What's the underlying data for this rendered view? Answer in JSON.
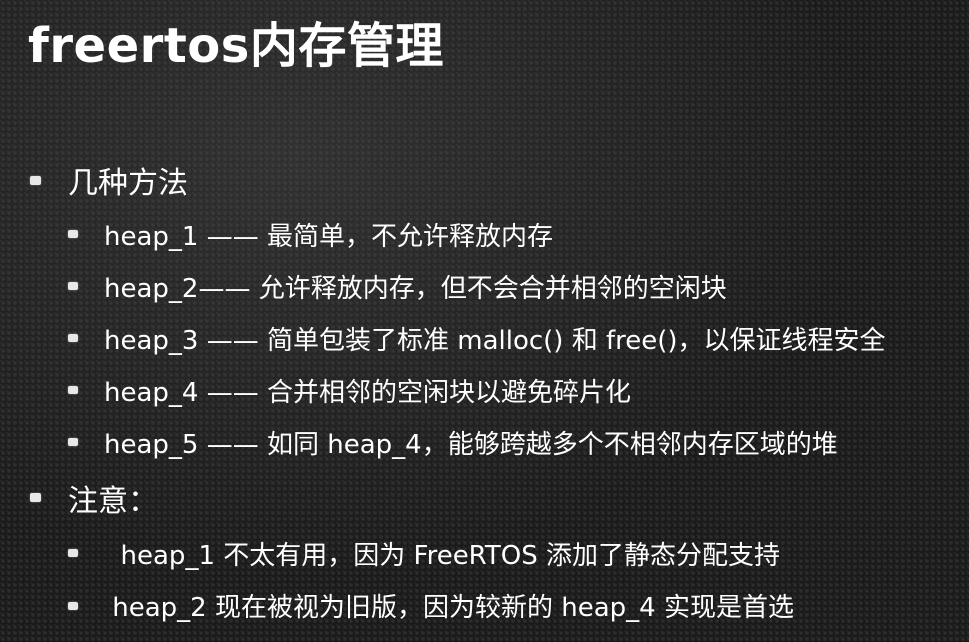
{
  "title": "freertos内存管理",
  "sections": [
    {
      "heading": "几种方法",
      "items": [
        "heap_1 —— 最简单，不允许释放内存",
        "heap_2—— 允许释放内存，但不会合并相邻的空闲块",
        "heap_3 —— 简单包装了标准 malloc() 和 free()，以保证线程安全",
        "heap_4 —— 合并相邻的空闲块以避免碎片化",
        "heap_5 —— 如同 heap_4，能够跨越多个不相邻内存区域的堆"
      ]
    },
    {
      "heading": "注意：",
      "items": [
        "  heap_1 不太有用，因为 FreeRTOS 添加了静态分配支持",
        " heap_2 现在被视为旧版，因为较新的 heap_4 实现是首选"
      ]
    }
  ],
  "colors": {
    "background": "#1a1a1a",
    "text": "#ffffff",
    "bullet": "#e8e8e8"
  }
}
